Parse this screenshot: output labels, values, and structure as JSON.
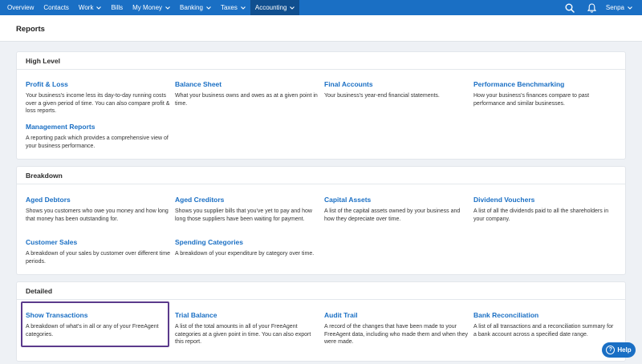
{
  "nav": {
    "items": [
      {
        "label": "Overview",
        "dropdown": false
      },
      {
        "label": "Contacts",
        "dropdown": false
      },
      {
        "label": "Work",
        "dropdown": true
      },
      {
        "label": "Bills",
        "dropdown": false
      },
      {
        "label": "My Money",
        "dropdown": true
      },
      {
        "label": "Banking",
        "dropdown": true
      },
      {
        "label": "Taxes",
        "dropdown": true
      },
      {
        "label": "Accounting",
        "dropdown": true,
        "active": true
      }
    ],
    "user": "Senpa",
    "search_icon": "search-icon",
    "notifications_icon": "bell-icon",
    "accent_color": "#1a6fc4",
    "active_color": "#104f8f"
  },
  "page": {
    "title": "Reports"
  },
  "sections": [
    {
      "heading": "High Level",
      "items": [
        {
          "title": "Profit & Loss",
          "desc": "Your business's income less its day-to-day running costs over a given period of time. You can also compare profit & loss reports."
        },
        {
          "title": "Balance Sheet",
          "desc": "What your business owns and owes as at a given point in time."
        },
        {
          "title": "Final Accounts",
          "desc": "Your business's year-end financial statements."
        },
        {
          "title": "Performance Benchmarking",
          "desc": "How your business's finances compare to past performance and similar businesses."
        },
        {
          "title": "Management Reports",
          "desc": "A reporting pack which provides a comprehensive view of your business performance."
        }
      ]
    },
    {
      "heading": "Breakdown",
      "items": [
        {
          "title": "Aged Debtors",
          "desc": "Shows you customers who owe you money and how long that money has been outstanding for."
        },
        {
          "title": "Aged Creditors",
          "desc": "Shows you supplier bills that you've yet to pay and how long those suppliers have been waiting for payment."
        },
        {
          "title": "Capital Assets",
          "desc": "A list of the capital assets owned by your business and how they depreciate over time."
        },
        {
          "title": "Dividend Vouchers",
          "desc": "A list of all the dividends paid to all the shareholders in your company."
        },
        {
          "title": "Customer Sales",
          "desc": "A breakdown of your sales by customer over different time periods."
        },
        {
          "title": "Spending Categories",
          "desc": "A breakdown of your expenditure by category over time."
        }
      ]
    },
    {
      "heading": "Detailed",
      "items": [
        {
          "title": "Show Transactions",
          "desc": "A breakdown of what's in all or any of your FreeAgent categories."
        },
        {
          "title": "Trial Balance",
          "desc": "A list of the total amounts in all of your FreeAgent categories at a given point in time. You can also export this report."
        },
        {
          "title": "Audit Trail",
          "desc": "A record of the changes that have been made to your FreeAgent data, including who made them and when they were made."
        },
        {
          "title": "Bank Reconciliation",
          "desc": "A list of all transactions and a reconciliation summary for a bank account across a specified date range."
        }
      ]
    }
  ],
  "help": {
    "label": "Help",
    "icon": "question-icon"
  }
}
